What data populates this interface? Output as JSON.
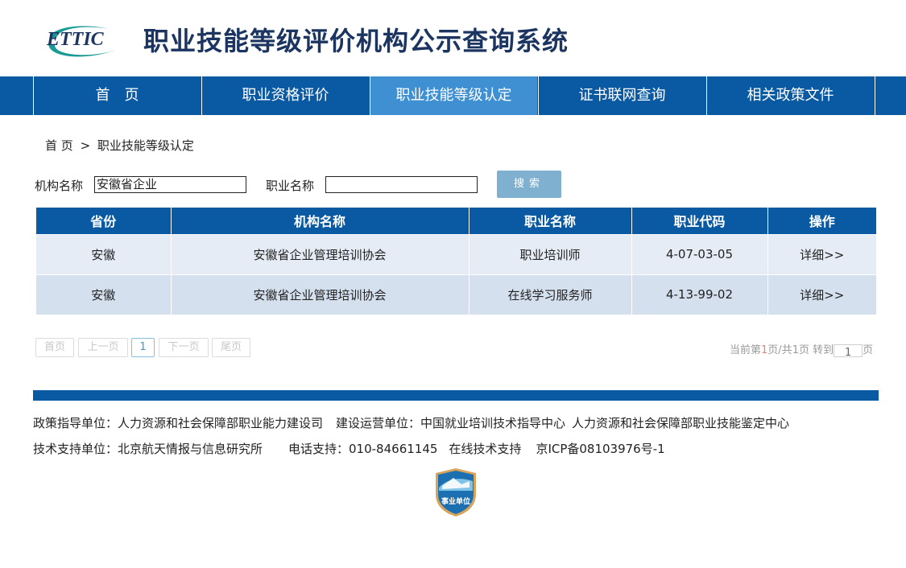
{
  "header": {
    "logo_text": "ETTIC",
    "title": "职业技能等级评价机构公示查询系统"
  },
  "nav": {
    "items": [
      {
        "label": "首　页"
      },
      {
        "label": "职业资格评价"
      },
      {
        "label": "职业技能等级认定"
      },
      {
        "label": "证书联网查询"
      },
      {
        "label": "相关政策文件"
      }
    ],
    "active_index": 2
  },
  "breadcrumb": {
    "home": "首 页",
    "separator": ">",
    "current": "职业技能等级认定"
  },
  "search": {
    "org_label": "机构名称",
    "org_value": "安徽省企业",
    "occupation_label": "职业名称",
    "occupation_value": "",
    "button_label": "搜索"
  },
  "table": {
    "headers": [
      "省份",
      "机构名称",
      "职业名称",
      "职业代码",
      "操作"
    ],
    "rows": [
      {
        "province": "安徽",
        "org": "安徽省企业管理培训协会",
        "occupation": "职业培训师",
        "code": "4-07-03-05",
        "action": "详细>>"
      },
      {
        "province": "安徽",
        "org": "安徽省企业管理培训协会",
        "occupation": "在线学习服务师",
        "code": "4-13-99-02",
        "action": "详细>>"
      }
    ]
  },
  "pager": {
    "first": "首页",
    "prev": "上一页",
    "current": "1",
    "next": "下一页",
    "last": "尾页",
    "info_prefix": "当前第",
    "current_page": "1",
    "info_mid": "页/共",
    "total_pages": "1",
    "info_goto": "页 转到",
    "goto_value": "1",
    "info_suffix": "页"
  },
  "footer": {
    "policy_unit": "政策指导单位：人力资源和社会保障部职业能力建设司",
    "operator_unit": "建设运营单位：中国就业培训技术指导中心",
    "operator_unit_2": "人力资源和社会保障部职业技能鉴定中心",
    "tech_unit": "技术支持单位：北京航天情报与信息研究所",
    "phone": "电话支持：010-84661145",
    "online_support": "在线技术支持",
    "icp": "京ICP备08103976号-1",
    "badge_text": "事业单位"
  },
  "colors": {
    "primary": "#0a5aa3",
    "nav_active": "#3f8fd3",
    "search_button": "#7fb0cf",
    "row_odd": "#e6ecf5",
    "row_even": "#d5e0ee",
    "logo_teal": "#1a9a94",
    "title": "#1b3560"
  }
}
